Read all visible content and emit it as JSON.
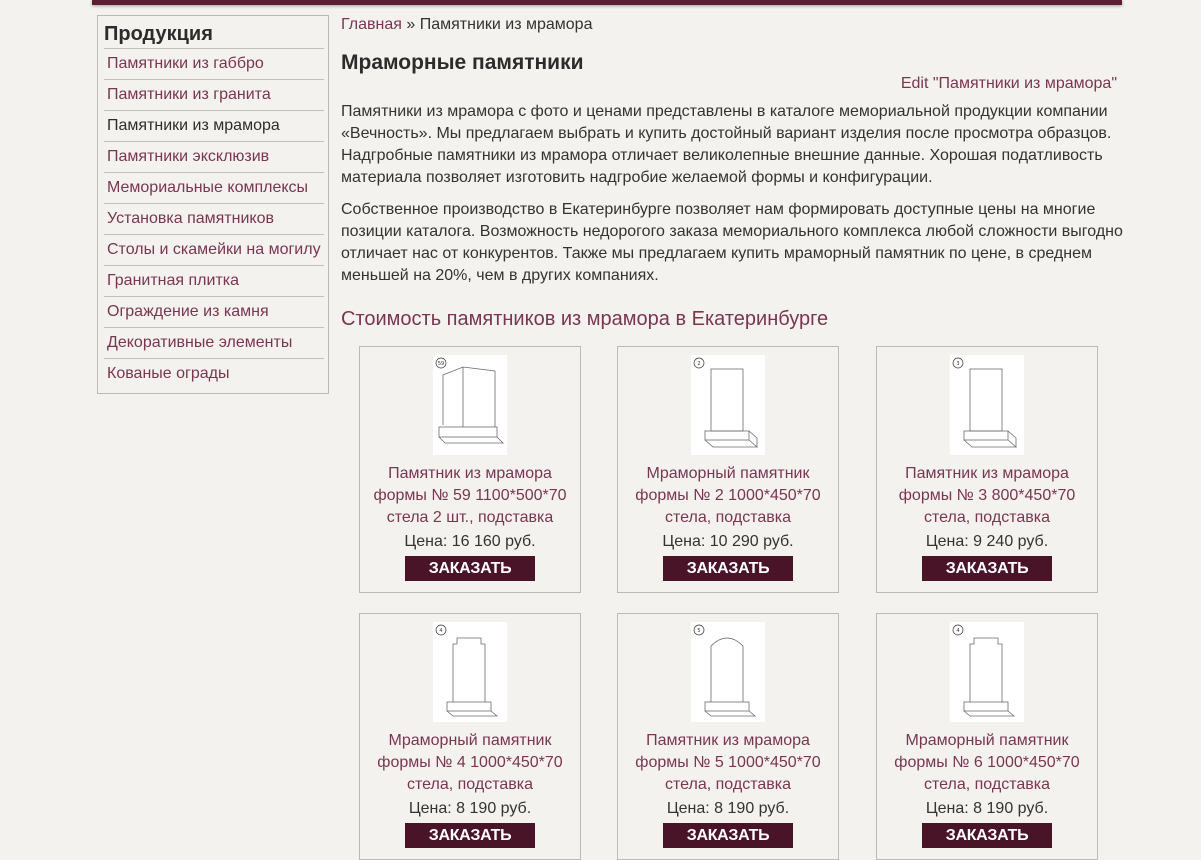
{
  "sidebar": {
    "title": "Продукция",
    "items": [
      {
        "label": "Памятники из габбро"
      },
      {
        "label": "Памятники из гранита"
      },
      {
        "label": "Памятники из мрамора"
      },
      {
        "label": "Памятники эксклюзив"
      },
      {
        "label": "Мемориальные комплексы"
      },
      {
        "label": "Установка памятников"
      },
      {
        "label": "Столы и скамейки на могилу"
      },
      {
        "label": "Гранитная плитка"
      },
      {
        "label": "Ограждение из камня"
      },
      {
        "label": "Декоративные элементы"
      },
      {
        "label": "Кованые ограды"
      }
    ],
    "active_index": 2
  },
  "breadcrumb": {
    "home": "Главная",
    "separator": "»",
    "current": "Памятники из мрамора"
  },
  "page": {
    "title": "Мраморные памятники",
    "edit_link": "Edit \"Памятники из мрамора\"",
    "intro_1": "Памятники из мрамора с фото и ценами представлены в каталоге мемориальной продукции компании «Вечность». Мы предлагаем выбрать и купить достойный вариант изделия после просмотра образцов. Надгробные памятники из мрамора отличает великолепные внешние данные. Хорошая податливость материала позволяет изготовить надгробие желаемой формы и конфигурации.",
    "intro_2": "Собственное производство в Екатеринбурге позволяет нам формировать доступные цены на многие позиции каталога. Возможность недорогого заказа мемориального комплекса любой сложности выгодно отличает нас от конкурентов. Также мы предлагаем купить мраморный памятник по цене, в среднем меньшей на 20%, чем в других компаниях.",
    "section_title": "Стоимость памятников из мрамора в Екатеринбурге"
  },
  "products": [
    {
      "number": "59",
      "name": "Памятник из мрамора формы № 59 1100*500*70 стела 2 шт., подставка",
      "price": "Цена: 16 160 руб.",
      "button": "ЗАКАЗАТЬ",
      "shape": "double"
    },
    {
      "number": "2",
      "name": "Мраморный памятник формы № 2 1000*450*70 стела, подставка",
      "price": "Цена: 10 290 руб.",
      "button": "ЗАКАЗАТЬ",
      "shape": "rect"
    },
    {
      "number": "3",
      "name": "Памятник из мрамора формы № 3 800*450*70 стела, подставка",
      "price": "Цена: 9 240 руб.",
      "button": "ЗАКАЗАТЬ",
      "shape": "rect"
    },
    {
      "number": "4",
      "name": "Мраморный памятник формы № 4 1000*450*70 стела, подставка",
      "price": "Цена: 8 190 руб.",
      "button": "ЗАКАЗАТЬ",
      "shape": "notch"
    },
    {
      "number": "5",
      "name": "Памятник из мрамора формы № 5 1000*450*70 стела, подставка",
      "price": "Цена: 8 190 руб.",
      "button": "ЗАКАЗАТЬ",
      "shape": "arch"
    },
    {
      "number": "4",
      "name": "Мраморный памятник формы № 6 1000*450*70 стела, подставка",
      "price": "Цена: 8 190 руб.",
      "button": "ЗАКАЗАТЬ",
      "shape": "notch"
    }
  ],
  "colors": {
    "accent": "#7a3552",
    "button": "#4a1428",
    "background": "#f4f2ee"
  }
}
